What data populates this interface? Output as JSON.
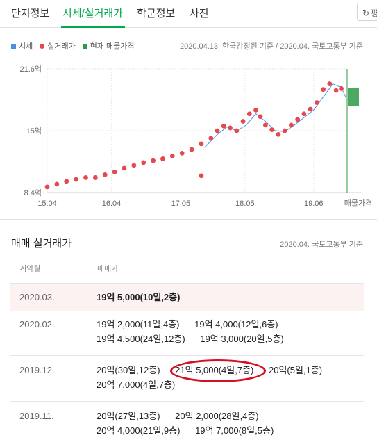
{
  "tabs": [
    {
      "label": "단지정보",
      "active": false
    },
    {
      "label": "시세/실거래가",
      "active": true
    },
    {
      "label": "학군정보",
      "active": false
    },
    {
      "label": "사진",
      "active": false
    }
  ],
  "more_button": {
    "icon": "refresh-icon",
    "label": "평"
  },
  "legend": {
    "items": [
      {
        "label": "시세",
        "color": "#4a90e2"
      },
      {
        "label": "실거래가",
        "color": "#e5484d"
      },
      {
        "label": "현재 매물가격",
        "color": "#2e9a45"
      }
    ],
    "source": "2020.04.13. 한국감정원 기준 / 2020.04. 국토교통부 기준"
  },
  "chart_data": {
    "type": "scatter",
    "y_ticks": [
      "21.6억",
      "15억",
      "8.4억"
    ],
    "ylim": [
      8.4,
      21.6
    ],
    "x_ticks": [
      "15.04",
      "16.04",
      "17.05",
      "18.05",
      "19.06",
      "매물가격"
    ],
    "series": [
      {
        "name": "실거래가",
        "color": "#e5484d",
        "type": "scatter",
        "points": [
          [
            2015.3,
            9.0
          ],
          [
            2015.45,
            9.3
          ],
          [
            2015.6,
            9.6
          ],
          [
            2015.75,
            9.8
          ],
          [
            2015.9,
            10.0
          ],
          [
            2016.05,
            10.0
          ],
          [
            2016.2,
            10.3
          ],
          [
            2016.35,
            10.6
          ],
          [
            2016.5,
            11.0
          ],
          [
            2016.65,
            11.3
          ],
          [
            2016.8,
            11.6
          ],
          [
            2016.95,
            11.8
          ],
          [
            2017.1,
            12.0
          ],
          [
            2017.25,
            12.3
          ],
          [
            2017.4,
            12.6
          ],
          [
            2017.55,
            13.0
          ],
          [
            2017.7,
            13.6
          ],
          [
            2017.85,
            14.2
          ],
          [
            2017.95,
            15.0
          ],
          [
            2018.05,
            15.5
          ],
          [
            2018.15,
            15.3
          ],
          [
            2018.25,
            15.0
          ],
          [
            2018.35,
            16.0
          ],
          [
            2018.45,
            16.8
          ],
          [
            2018.55,
            17.2
          ],
          [
            2018.62,
            16.5
          ],
          [
            2018.7,
            15.6
          ],
          [
            2018.8,
            15.1
          ],
          [
            2018.9,
            14.6
          ],
          [
            2019.0,
            15.0
          ],
          [
            2019.1,
            15.6
          ],
          [
            2019.2,
            16.2
          ],
          [
            2019.3,
            16.8
          ],
          [
            2019.4,
            17.3
          ],
          [
            2019.5,
            18.0
          ],
          [
            2019.6,
            19.4
          ],
          [
            2019.7,
            20.0
          ],
          [
            2019.8,
            19.3
          ],
          [
            2019.88,
            19.5
          ],
          [
            2017.7,
            10.2
          ]
        ]
      },
      {
        "name": "시세",
        "color": "#4a90e2",
        "type": "line",
        "points": [
          [
            2017.75,
            13.2
          ],
          [
            2017.95,
            14.6
          ],
          [
            2018.1,
            15.4
          ],
          [
            2018.25,
            15.0
          ],
          [
            2018.4,
            15.6
          ],
          [
            2018.55,
            16.8
          ],
          [
            2018.7,
            16.0
          ],
          [
            2018.85,
            15.0
          ],
          [
            2019.0,
            14.9
          ],
          [
            2019.15,
            15.6
          ],
          [
            2019.3,
            16.4
          ],
          [
            2019.45,
            17.2
          ],
          [
            2019.6,
            18.6
          ],
          [
            2019.75,
            20.0
          ],
          [
            2019.88,
            19.6
          ],
          [
            2019.95,
            18.6
          ]
        ]
      },
      {
        "name": "현재 매물가격",
        "color": "#2e9a45",
        "type": "range",
        "x": "매물가격",
        "low": 17.6,
        "high": 19.6
      }
    ]
  },
  "trades": {
    "title": "매매 실거래가",
    "source": "2020.04. 국토교통부 기준",
    "headers": {
      "month": "계약월",
      "price": "매매가"
    },
    "rows": [
      {
        "month": "2020.03.",
        "highlight": true,
        "lines": [
          [
            "19억 5,000(10일,2층)"
          ]
        ]
      },
      {
        "month": "2020.02.",
        "highlight": false,
        "lines": [
          [
            "19억 2,000(11일,4층)",
            "19억 4,000(12일,6층)"
          ],
          [
            "19억 4,500(24일,12층)",
            "19억 3,000(20일,5층)"
          ]
        ]
      },
      {
        "month": "2019.12.",
        "highlight": false,
        "lines": [
          [
            "20억(30일,12층)",
            "21억 5,000(4일,7층)",
            "20억(5일,1층)"
          ],
          [
            "20억 7,000(4일,7층)"
          ]
        ]
      },
      {
        "month": "2019.11.",
        "highlight": false,
        "lines": [
          [
            "20억(27일,13층)",
            "20억 2,000(28일,4층)"
          ],
          [
            "20억 4,000(21일,9층)",
            "19억 7,000(8일,5층)"
          ]
        ]
      }
    ]
  }
}
